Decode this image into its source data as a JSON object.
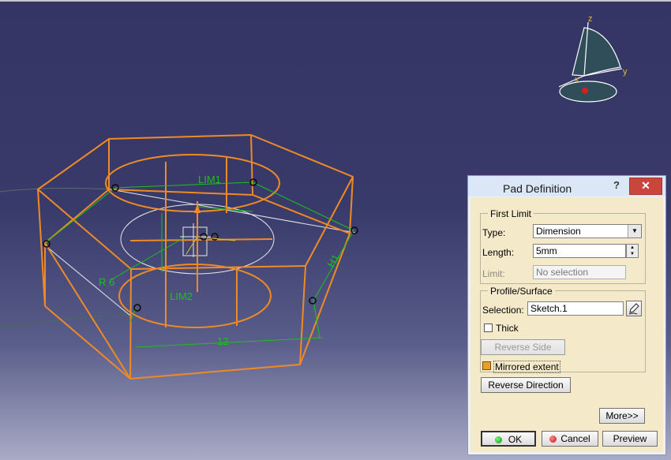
{
  "viewport": {
    "annotations": {
      "lim1": "LIM1",
      "lim2": "LIM2",
      "radius": "R 6",
      "dim_side": "H1",
      "dim_bottom": "12"
    },
    "compass": {
      "x": "x",
      "y": "y",
      "z": "z"
    },
    "colors": {
      "edges": "#f08a24",
      "constraints": "#19c219",
      "background": "#353565"
    }
  },
  "dialog": {
    "title": "Pad Definition",
    "help": "?",
    "close": "✕",
    "first_limit": {
      "legend": "First Limit",
      "type_label": "Type:",
      "type_value": "Dimension",
      "length_label": "Length:",
      "length_value": "5mm",
      "limit_label": "Limit:",
      "limit_value": "No selection"
    },
    "profile": {
      "legend": "Profile/Surface",
      "selection_label": "Selection:",
      "selection_value": "Sketch.1",
      "thick_label": "Thick",
      "thick_checked": false,
      "reverse_side_label": "Reverse Side"
    },
    "mirrored_label": "Mirrored extent",
    "mirrored_checked": true,
    "reverse_direction_label": "Reverse Direction",
    "more_label": "More>>",
    "ok_label": "OK",
    "cancel_label": "Cancel",
    "preview_label": "Preview"
  }
}
